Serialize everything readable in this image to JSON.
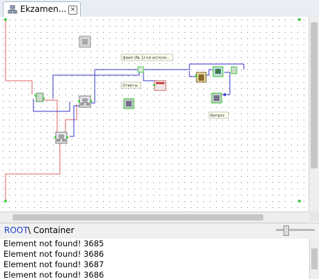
{
  "tab": {
    "title": "Ekzamen...",
    "close_glyph": "×",
    "icon": "diagram-icon"
  },
  "canvas": {
    "labels": {
      "top_label": "фаил (№ 1) на исполн..",
      "answers_label": "Ответы",
      "question_label": "Вопрос"
    },
    "colors": {
      "grid_dot": "#888888",
      "wire_blue": "#3333cc",
      "wire_red": "#e06060",
      "port_green": "#44cc44",
      "node_fill": "#c8c8d0"
    }
  },
  "breadcrumb": {
    "root": "ROOT",
    "rest": "\\ Container"
  },
  "console": {
    "lines": [
      "Element not found! 3685",
      "Element not found! 3686",
      "Element not found! 3687",
      "Element not found! 3686"
    ]
  }
}
